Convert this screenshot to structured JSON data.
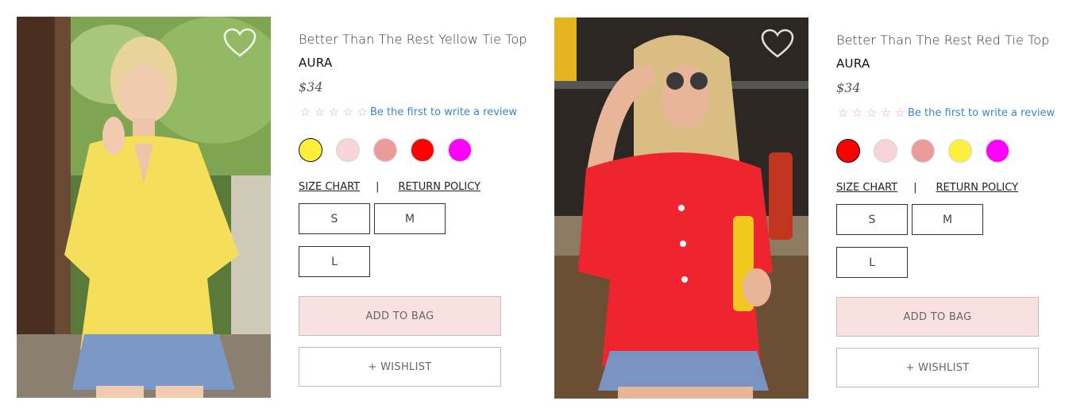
{
  "products": [
    {
      "title": "Better Than The Rest Yellow Tie Top",
      "brand": "AURA",
      "price": "$34",
      "review_link": "Be the first to write a review",
      "stars": [
        "☆",
        "☆",
        "☆",
        "☆",
        "☆"
      ],
      "swatches": [
        "#ffef3d",
        "#f6d4d7",
        "#ec9a9a",
        "#ff0000",
        "#ff00ff"
      ],
      "selected_swatch": 0,
      "size_chart": "SIZE CHART",
      "separator": "|",
      "return_policy": "RETURN POLICY",
      "sizes": [
        "S",
        "M",
        "L"
      ],
      "add_to_bag": "ADD TO BAG",
      "wishlist": "+ WISHLIST",
      "heart_icon": "heart-outline-icon"
    },
    {
      "title": "Better Than The Rest Red Tie Top",
      "brand": "AURA",
      "price": "$34",
      "review_link": "Be the first to write a review",
      "stars": [
        "☆",
        "☆",
        "☆",
        "☆",
        "☆"
      ],
      "swatches": [
        "#ff0000",
        "#f6d4d7",
        "#ec9a9a",
        "#ffef3d",
        "#ff00ff"
      ],
      "selected_swatch": 0,
      "size_chart": "SIZE CHART",
      "separator": "|",
      "return_policy": "RETURN POLICY",
      "sizes": [
        "S",
        "M",
        "L"
      ],
      "add_to_bag": "ADD TO BAG",
      "wishlist": "+ WISHLIST",
      "heart_icon": "heart-outline-icon"
    }
  ]
}
